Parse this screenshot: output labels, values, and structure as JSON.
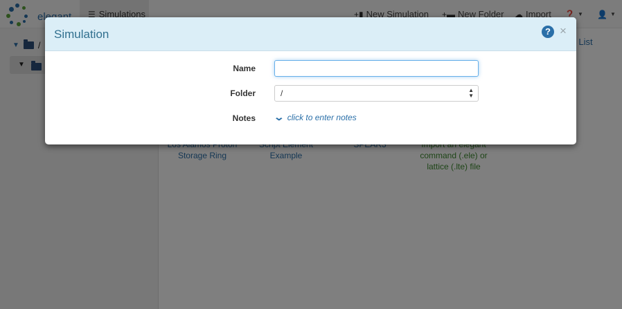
{
  "navbar": {
    "brand": "elegant",
    "active_tab": "Simulations",
    "new_simulation": "New Simulation",
    "new_folder": "New Folder",
    "import": "Import"
  },
  "sidebar": {
    "root_folder": "/"
  },
  "main": {
    "view_toggle": "as List",
    "items": [
      {
        "line1": "Los Alamos Proton",
        "line2": "Storage Ring",
        "line3": ""
      },
      {
        "line1": "Script Element",
        "line2": "Example",
        "line3": ""
      },
      {
        "line1": "SPEAR3",
        "line2": "",
        "line3": ""
      },
      {
        "line1": "Import an elegant",
        "line2": "command (.ele) or",
        "line3": "lattice (.lte) file"
      }
    ]
  },
  "modal": {
    "title": "Simulation",
    "help_glyph": "?",
    "close_glyph": "×",
    "name_label": "Name",
    "name_value": "",
    "folder_label": "Folder",
    "folder_value": "/",
    "notes_label": "Notes",
    "notes_link": "click to enter notes"
  },
  "colors": {
    "accent": "#2a6fa8",
    "modal_header": "#dbeef7",
    "import_text": "#3c8a2e"
  }
}
